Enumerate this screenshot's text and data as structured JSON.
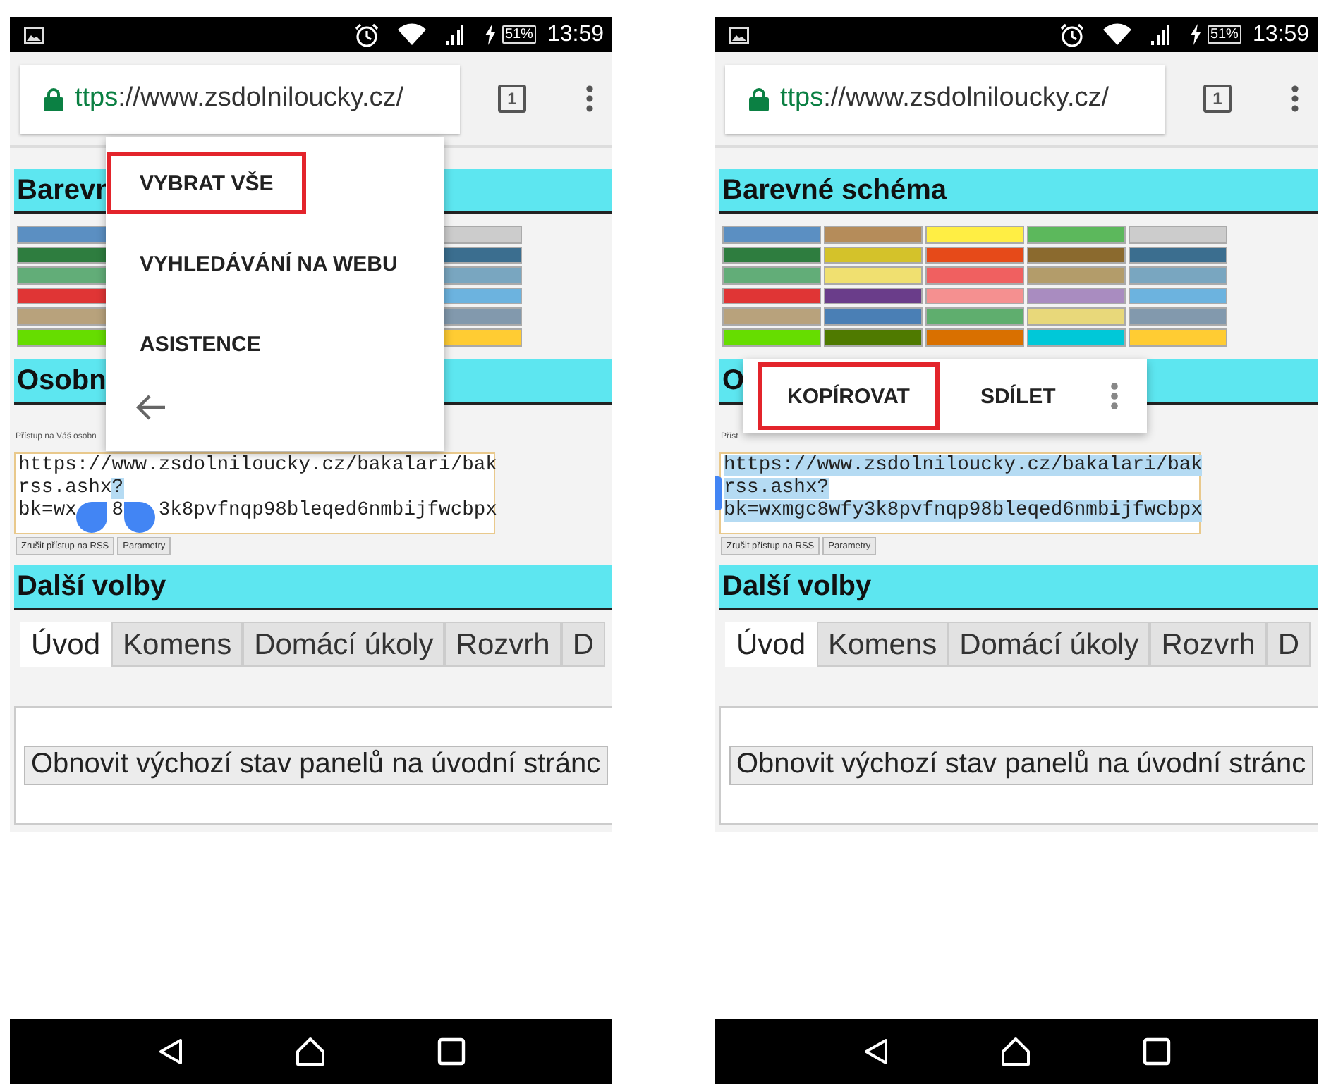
{
  "phones": [
    {
      "status_bar": {
        "battery": "51%",
        "time": "13:59"
      },
      "toolbar": {
        "url_scheme": "ttps",
        "url_rest": "://www.zsdolniloucky.cz/",
        "tab_count": "1"
      },
      "page": {
        "color_heading": "Barevn",
        "color_grid": [
          [
            {
              "color": "#5b8fc2"
            },
            {
              "color": "#cccccc"
            }
          ],
          [
            {
              "color": "#2e7d3f"
            },
            {
              "color": "#3b6e8f"
            }
          ],
          [
            {
              "color": "#62ad78"
            },
            {
              "color": "#79a6c0"
            }
          ],
          [
            {
              "color": "#e03535"
            },
            {
              "color": "#6cb3df"
            }
          ],
          [
            {
              "color": "#b8a27c"
            },
            {
              "color": "#8299ad"
            }
          ],
          [
            {
              "color": "#66dd00"
            },
            {
              "color": "#ffcc33"
            }
          ]
        ],
        "personal_heading": "Osobn",
        "rss_note": "Přístup na Váš osobn",
        "rss_field": {
          "lines": [
            [
              {
                "kind": "text",
                "text": "https://www.zsdolniloucky.cz/bakalari/bak",
                "selected": false
              }
            ],
            [
              {
                "kind": "text",
                "text": "rss.ashx",
                "selected": false
              },
              {
                "kind": "text",
                "text": "?",
                "selected": true
              }
            ],
            [
              {
                "kind": "text",
                "text": "bk=wx",
                "selected": false
              },
              {
                "kind": "start_handle"
              },
              {
                "kind": "text",
                "text": "8",
                "selected": false
              },
              {
                "kind": "end_handle"
              },
              {
                "kind": "text",
                "text": "3k8pvfnqp98bleqed6nmbijfwcbpx",
                "selected": false
              }
            ]
          ]
        },
        "rss_buttons": [
          "Zrušit přístup na RSS",
          "Parametry"
        ],
        "more_heading": "Další volby",
        "tabs": [
          {
            "label": "Úvod",
            "selected": true
          },
          {
            "label": "Komens",
            "selected": false
          },
          {
            "label": "Domácí úkoly",
            "selected": false
          },
          {
            "label": "Rozvrh",
            "selected": false
          },
          {
            "label": "D",
            "selected": false
          }
        ],
        "reset_button": "Obnovit výchozí stav panelů na úvodní stránc"
      },
      "overlay": {
        "kind": "menu",
        "items": [
          {
            "kind": "text",
            "label": "VYBRAT VŠE",
            "highlighted": true
          },
          {
            "kind": "text",
            "label": "VYHLEDÁVÁNÍ NA WEBU",
            "highlighted": false
          },
          {
            "kind": "text",
            "label": "ASISTENCE",
            "highlighted": false
          },
          {
            "kind": "back"
          }
        ]
      }
    },
    {
      "status_bar": {
        "battery": "51%",
        "time": "13:59"
      },
      "toolbar": {
        "url_scheme": "ttps",
        "url_rest": "://www.zsdolniloucky.cz/",
        "tab_count": "1"
      },
      "page": {
        "color_heading": "Barevné schéma",
        "color_grid": [
          [
            {
              "color": "#5b8fc2"
            },
            {
              "color": "#b58c5a"
            },
            {
              "color": "#ffee44"
            },
            {
              "color": "#5cb85c"
            },
            {
              "color": "#cccccc"
            }
          ],
          [
            {
              "color": "#2e7d3f"
            },
            {
              "color": "#d4c22a"
            },
            {
              "color": "#e64a19"
            },
            {
              "color": "#8b6a2e"
            },
            {
              "color": "#3b6e8f"
            }
          ],
          [
            {
              "color": "#62ad78"
            },
            {
              "color": "#f0e070"
            },
            {
              "color": "#f06060"
            },
            {
              "color": "#b39c6a"
            },
            {
              "color": "#79a6c0"
            }
          ],
          [
            {
              "color": "#e03535"
            },
            {
              "color": "#6a3d8a"
            },
            {
              "color": "#f59090"
            },
            {
              "color": "#a98cc0"
            },
            {
              "color": "#6cb3df"
            }
          ],
          [
            {
              "color": "#b8a27c"
            },
            {
              "color": "#4a7fb5"
            },
            {
              "color": "#5fae6e"
            },
            {
              "color": "#e8d87a"
            },
            {
              "color": "#8299ad"
            }
          ],
          [
            {
              "color": "#66dd00"
            },
            {
              "color": "#4f7a00"
            },
            {
              "color": "#d97000"
            },
            {
              "color": "#00c8d8"
            },
            {
              "color": "#ffcc33"
            }
          ]
        ],
        "personal_heading": "O",
        "rss_note": "Příst",
        "rss_field": {
          "edge_handle": true,
          "lines": [
            [
              {
                "kind": "text",
                "text": "https://www.zsdolniloucky.cz/bakalari/bak",
                "selected": true
              }
            ],
            [
              {
                "kind": "text",
                "text": "rss.ashx?",
                "selected": true
              }
            ],
            [
              {
                "kind": "text",
                "text": "bk=wxmgc8wfy3k8pvfnqp98bleqed6nmbijfwcbpx",
                "selected": true
              }
            ]
          ]
        },
        "rss_buttons": [
          "Zrušit přístup na RSS",
          "Parametry"
        ],
        "more_heading": "Další volby",
        "tabs": [
          {
            "label": "Úvod",
            "selected": true
          },
          {
            "label": "Komens",
            "selected": false
          },
          {
            "label": "Domácí úkoly",
            "selected": false
          },
          {
            "label": "Rozvrh",
            "selected": false
          },
          {
            "label": "D",
            "selected": false
          }
        ],
        "reset_button": "Obnovit výchozí stav panelů na úvodní stránc"
      },
      "overlay": {
        "kind": "action_bar",
        "items": [
          {
            "kind": "text",
            "label": "KOPÍROVAT",
            "highlighted": true
          },
          {
            "kind": "text",
            "label": "SDÍLET",
            "highlighted": false
          },
          {
            "kind": "more"
          }
        ]
      }
    }
  ]
}
